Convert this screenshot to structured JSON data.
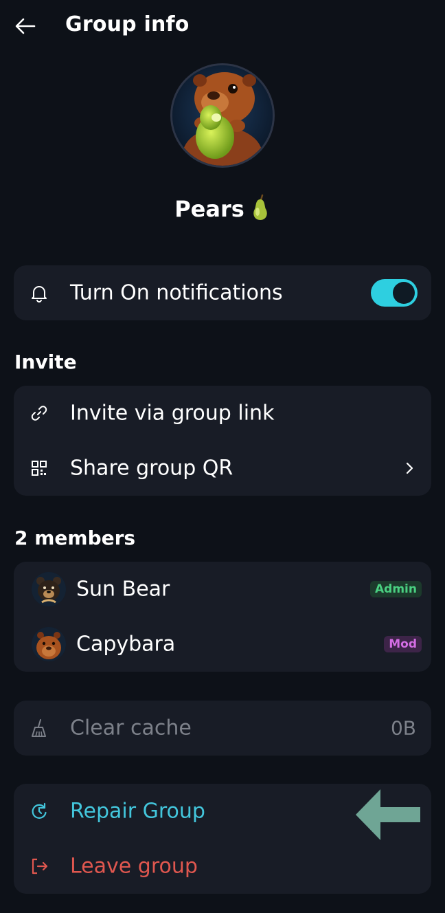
{
  "header": {
    "title": "Group info",
    "back_icon": "arrow-left-icon"
  },
  "group": {
    "name": "Pears",
    "emoji_icon": "pear-emoji-icon",
    "avatar": "capybara-eating-pear-avatar"
  },
  "notifications": {
    "label": "Turn On notifications",
    "enabled": true,
    "icon": "bell-icon",
    "accent": "#2ecfe0"
  },
  "invite": {
    "title": "Invite",
    "items": [
      {
        "label": "Invite via group link",
        "icon": "link-icon"
      },
      {
        "label": "Share group QR",
        "icon": "qr-code-icon"
      }
    ]
  },
  "members": {
    "title": "2 members",
    "items": [
      {
        "name": "Sun Bear",
        "badge": "Admin",
        "avatar": "sun-bear-avatar"
      },
      {
        "name": "Capybara",
        "badge": "Mod",
        "avatar": "capybara-avatar"
      }
    ]
  },
  "cache": {
    "label": "Clear cache",
    "size": "0B",
    "icon": "broom-icon"
  },
  "actions": {
    "repair": {
      "label": "Repair Group",
      "icon": "refresh-icon",
      "color": "#43c6dc"
    },
    "leave": {
      "label": "Leave group",
      "icon": "logout-icon",
      "color": "#e0574f"
    }
  },
  "annotation": {
    "arrow_color": "#6fa595"
  }
}
